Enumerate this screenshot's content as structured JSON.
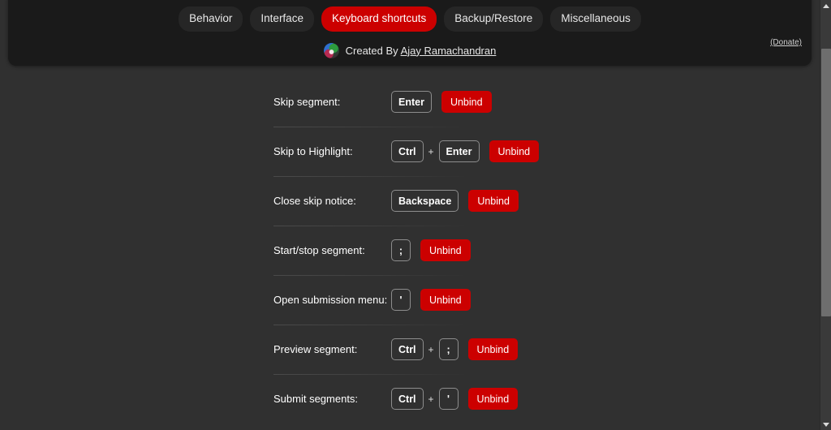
{
  "header": {
    "tabs": [
      {
        "label": "Behavior",
        "active": false
      },
      {
        "label": "Interface",
        "active": false
      },
      {
        "label": "Keyboard shortcuts",
        "active": true
      },
      {
        "label": "Backup/Restore",
        "active": false
      },
      {
        "label": "Miscellaneous",
        "active": false
      }
    ],
    "credit_prefix": "Created By ",
    "credit_author": "Ajay Ramachandran",
    "donate_label": "(Donate)",
    "logo_icon": "sponsorblock-logo-icon",
    "accent_color": "#cc0000",
    "panel_color": "#1a1a1a"
  },
  "page": {
    "background_color": "#303030",
    "unbind_label": "Unbind"
  },
  "shortcuts": [
    {
      "label": "Skip segment:",
      "keys": [
        "Enter"
      ],
      "unbind": "Unbind"
    },
    {
      "label": "Skip to Highlight:",
      "keys": [
        "Ctrl",
        "Enter"
      ],
      "unbind": "Unbind"
    },
    {
      "label": "Close skip notice:",
      "keys": [
        "Backspace"
      ],
      "unbind": "Unbind"
    },
    {
      "label": "Start/stop segment:",
      "keys": [
        ";"
      ],
      "unbind": "Unbind"
    },
    {
      "label": "Open submission menu:",
      "keys": [
        "'"
      ],
      "unbind": "Unbind"
    },
    {
      "label": "Preview segment:",
      "keys": [
        "Ctrl",
        ";"
      ],
      "unbind": "Unbind"
    },
    {
      "label": "Submit segments:",
      "keys": [
        "Ctrl",
        "'"
      ],
      "unbind": "Unbind"
    }
  ],
  "scrollbar": {
    "up_arrow_icon": "scroll-up-arrow-icon",
    "down_arrow_icon": "scroll-down-arrow-icon"
  }
}
